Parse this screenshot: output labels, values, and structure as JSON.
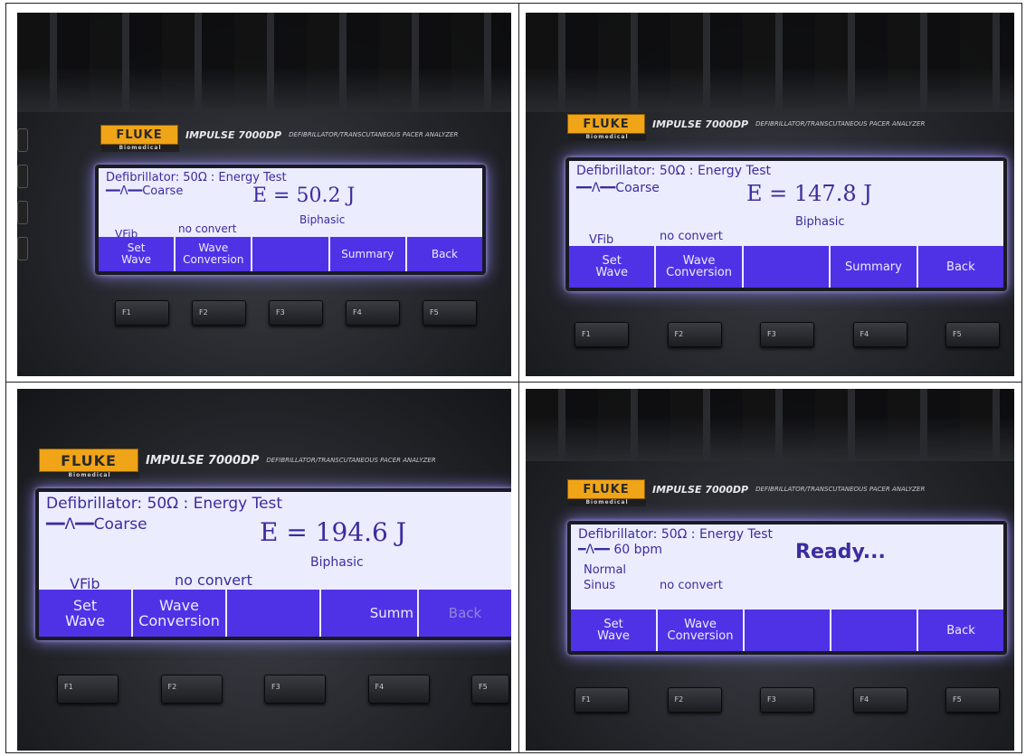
{
  "brand": {
    "logo": "FLUKE",
    "logo_sub": "Biomedical",
    "model": "IMPULSE 7000DP",
    "description": "DEFIBRILLATOR/TRANSCUTANEOUS PACER ANALYZER"
  },
  "panels": [
    {
      "line1": "Defibrillator:  50Ω : Energy Test",
      "waveform": "━━Λ━━Coarse",
      "energy": "E = 50.2 J",
      "mode": "Biphasic",
      "rhythm": "VFib",
      "conversion": "no convert",
      "softkeys": [
        "Set\nWave",
        "Wave\nConversion",
        "",
        "Summary",
        "Back"
      ],
      "fkeys": [
        "F1",
        "F2",
        "F3",
        "F4",
        "F5"
      ]
    },
    {
      "line1": "Defibrillator:  50Ω : Energy Test",
      "waveform": "━━Λ━━Coarse",
      "energy": "E = 147.8 J",
      "mode": "Biphasic",
      "rhythm": "VFib",
      "conversion": "no convert",
      "softkeys": [
        "Set\nWave",
        "Wave\nConversion",
        "",
        "Summary",
        "Back"
      ],
      "fkeys": [
        "F1",
        "F2",
        "F3",
        "F4",
        "F5"
      ]
    },
    {
      "line1": "Defibrillator:  50Ω : Energy Test",
      "waveform": "━━Λ━━Coarse",
      "energy": "E = 194.6 J",
      "mode": "Biphasic",
      "rhythm": "VFib",
      "conversion": "no convert",
      "softkeys": [
        "Set\nWave",
        "Wave\nConversion",
        "",
        "Summ",
        "Back"
      ],
      "fkeys": [
        "F1",
        "F2",
        "F3",
        "F4",
        "F5"
      ]
    },
    {
      "line1": "Defibrillator:  50Ω : Energy Test",
      "waveform": "━Λ━━ 60 bpm",
      "status": "Ready...",
      "rhythm": "Normal\nSinus",
      "conversion": "no convert",
      "softkeys": [
        "Set\nWave",
        "Wave\nConversion",
        "",
        "",
        "Back"
      ],
      "fkeys": [
        "F1",
        "F2",
        "F3",
        "F4",
        "F5"
      ]
    }
  ]
}
